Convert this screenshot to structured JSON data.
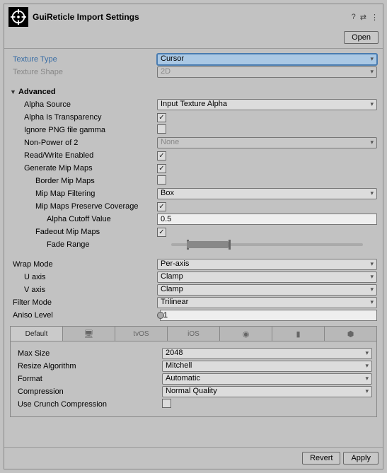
{
  "header": {
    "title": "GuiReticle Import Settings",
    "open": "Open"
  },
  "texture": {
    "type_label": "Texture Type",
    "type_value": "Cursor",
    "shape_label": "Texture Shape",
    "shape_value": "2D"
  },
  "advanced": {
    "title": "Advanced",
    "alpha_source_label": "Alpha Source",
    "alpha_source_value": "Input Texture Alpha",
    "alpha_trans_label": "Alpha Is Transparency",
    "ignore_png_label": "Ignore PNG file gamma",
    "npot_label": "Non-Power of 2",
    "npot_value": "None",
    "rw_label": "Read/Write Enabled",
    "genmip_label": "Generate Mip Maps",
    "border_label": "Border Mip Maps",
    "mipfilter_label": "Mip Map Filtering",
    "mipfilter_value": "Box",
    "preserve_label": "Mip Maps Preserve Coverage",
    "cutoff_label": "Alpha Cutoff Value",
    "cutoff_value": "0.5",
    "fadeout_label": "Fadeout Mip Maps",
    "faderange_label": "Fade Range"
  },
  "sampling": {
    "wrap_label": "Wrap Mode",
    "wrap_value": "Per-axis",
    "u_label": "U axis",
    "u_value": "Clamp",
    "v_label": "V axis",
    "v_value": "Clamp",
    "filter_label": "Filter Mode",
    "filter_value": "Trilinear",
    "aniso_label": "Aniso Level",
    "aniso_value": "1"
  },
  "platform": {
    "tabs": [
      "Default",
      "",
      "tvOS",
      "iOS",
      "",
      "",
      ""
    ],
    "maxsize_label": "Max Size",
    "maxsize_value": "2048",
    "resize_label": "Resize Algorithm",
    "resize_value": "Mitchell",
    "format_label": "Format",
    "format_value": "Automatic",
    "compression_label": "Compression",
    "compression_value": "Normal Quality",
    "crunch_label": "Use Crunch Compression"
  },
  "footer": {
    "revert": "Revert",
    "apply": "Apply"
  }
}
